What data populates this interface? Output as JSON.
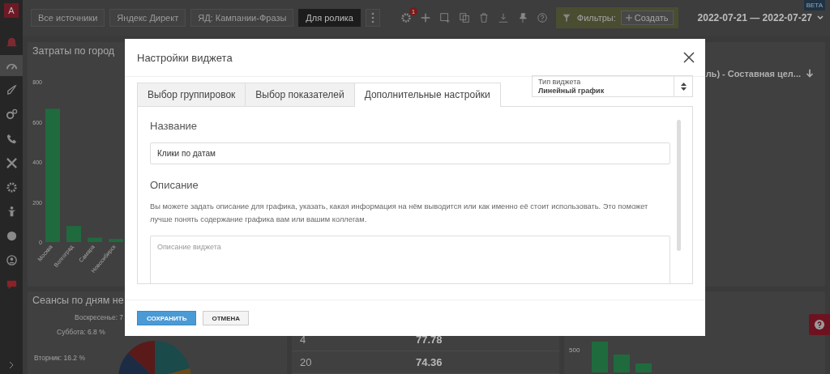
{
  "toolbar": {
    "logo": "A",
    "sources": [
      {
        "label": "Все источники",
        "selected": false
      },
      {
        "label": "Яндекс Директ",
        "selected": false
      },
      {
        "label": "ЯД: Кампании-Фразы",
        "selected": false
      },
      {
        "label": "Для ролика",
        "selected": true
      }
    ],
    "settings_badge": "1",
    "filters_label": "Фильтры:",
    "create_button": "Создать",
    "date_range": "2022-07-21 — 2022-07-27",
    "beta_badge": "BETA"
  },
  "sidebar": {
    "items": [
      {
        "selected": false
      },
      {
        "selected": true
      },
      {
        "selected": false
      },
      {
        "selected": false
      },
      {
        "selected": false
      },
      {
        "selected": false
      },
      {
        "selected": false
      },
      {
        "selected": false
      },
      {
        "selected": false
      },
      {
        "selected": false
      },
      {
        "selected": false
      }
    ]
  },
  "cost_panel": {
    "title": "Затраты по город",
    "chart_data": {
      "type": "bar",
      "categories": [
        "Москва",
        "Волгоград",
        "Самара",
        "Новосибирск"
      ],
      "values": [
        665,
        80,
        22,
        15
      ],
      "ylim": [
        0,
        800
      ],
      "yticks": [
        0,
        200,
        400,
        600,
        800
      ]
    }
  },
  "sessions_panel": {
    "title": "Сеансы по дням не",
    "pie_labels": [
      "Воскресенье: 7",
      "Суббота: 6.8 %",
      "Вторник: 16.2 %"
    ]
  },
  "table": {
    "rows": [
      {
        "col_1": "4",
        "col_2": "77.78"
      },
      {
        "col_1": "20",
        "col_2": "74.36"
      }
    ]
  },
  "right_panel": {
    "title": "ль) - Составная цел...",
    "axis_tick": "500"
  },
  "modal": {
    "title": "Настройки виджета",
    "tabs": [
      {
        "label": "Выбор группировок",
        "selected": false
      },
      {
        "label": "Выбор показателей",
        "selected": false
      },
      {
        "label": "Дополнительные настройки",
        "selected": true
      }
    ],
    "widget_type": {
      "label": "Тип виджета",
      "value": "Линейный график"
    },
    "name_label": "Название",
    "name_value": "Клики по датам",
    "description_label": "Описание",
    "description_help": "Вы можете задать описание для графика, указать, какая информация на нём выводится или как именно её стоит использовать. Это поможет лучше понять содержание графика вам или вашим коллегам.",
    "description_placeholder": "Описание виджета",
    "buttons": [
      {
        "label": "СОХРАНИТЬ",
        "kind": "primary"
      },
      {
        "label": "ОТМЕНА",
        "kind": "secondary"
      }
    ]
  }
}
